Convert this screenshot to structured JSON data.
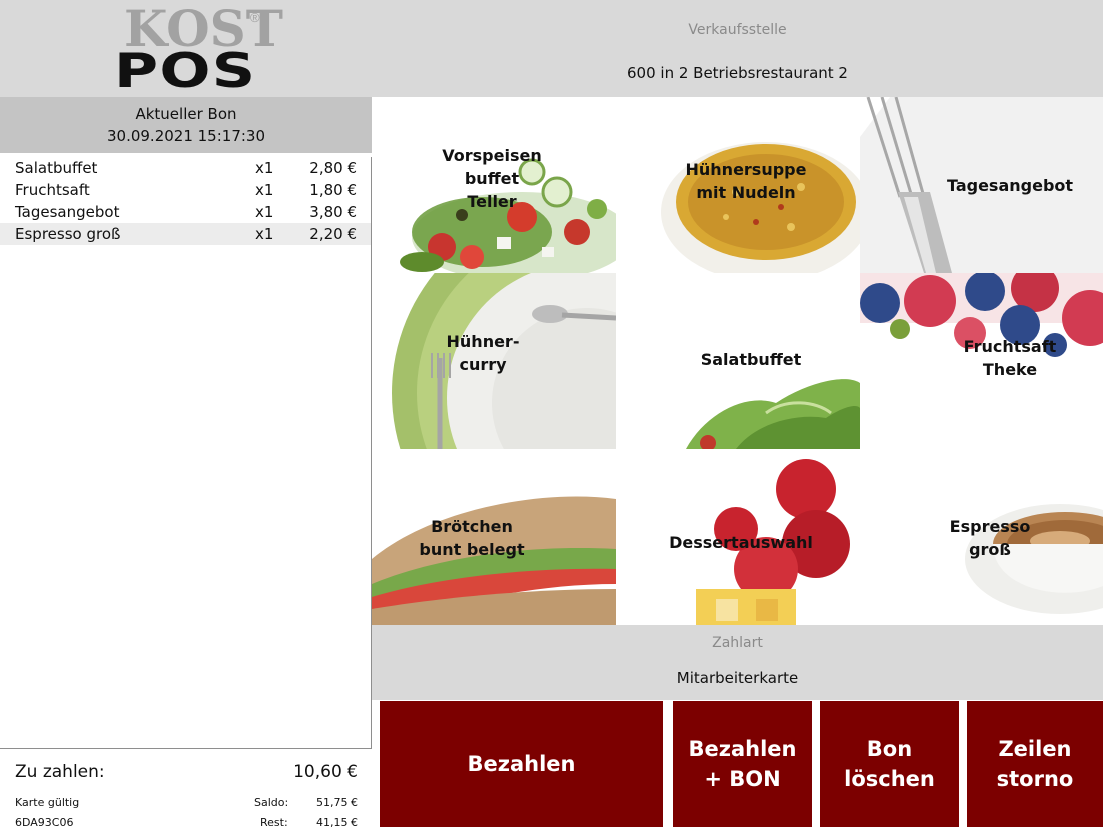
{
  "logo": {
    "top_text": "KOST",
    "registered": "®",
    "bottom_text": "POS"
  },
  "bon": {
    "title": "Aktueller Bon",
    "datetime": "30.09.2021 15:17:30",
    "items": [
      {
        "name": "Salatbuffet",
        "qty": "x1",
        "price": "2,80 €"
      },
      {
        "name": "Fruchtsaft",
        "qty": "x1",
        "price": "1,80 €"
      },
      {
        "name": "Tagesangebot",
        "qty": "x1",
        "price": "3,80 €"
      },
      {
        "name": "Espresso groß",
        "qty": "x1",
        "price": "2,20 €"
      }
    ]
  },
  "totals": {
    "label": "Zu zahlen:",
    "amount": "10,60 €",
    "card_label": "Karte gültig",
    "card_id": "6DA93C06",
    "saldo_label": "Saldo:",
    "saldo_value": "51,75 €",
    "rest_label": "Rest:",
    "rest_value": "41,15 €"
  },
  "venue": {
    "label": "Verkaufsstelle",
    "value": "600 in 2 Betriebsrestaurant 2"
  },
  "products": [
    {
      "label": "Vorspeisen\nbuffet\nTeller",
      "icon": "salad-plate-image"
    },
    {
      "label": "Hühnersuppe\nmit Nudeln",
      "icon": "soup-bowl-image"
    },
    {
      "label": "Tagesangebot",
      "icon": "fork-image"
    },
    {
      "label": "Hühner-\ncurry",
      "icon": "green-plate-image"
    },
    {
      "label": "Salatbuffet",
      "icon": "lettuce-image"
    },
    {
      "label": "Fruchtsaft\nTheke",
      "icon": "berries-image"
    },
    {
      "label": "Brötchen\nbunt belegt",
      "icon": "sandwich-image"
    },
    {
      "label": "Dessertauswahl",
      "icon": "fruit-dessert-image"
    },
    {
      "label": "Espresso\ngroß",
      "icon": "coffee-cup-image"
    }
  ],
  "payment": {
    "label": "Zahlart",
    "value": "Mitarbeiterkarte"
  },
  "buttons": {
    "pay": "Bezahlen",
    "pay_receipt": "Bezahlen\n+ BON",
    "delete_receipt": "Bon\nlöschen",
    "void_line": "Zeilen\nstorno"
  },
  "colors": {
    "button_bg": "#7c0000",
    "header_bg": "#d9d9d9",
    "bon_header_bg": "#c4c4c4"
  }
}
